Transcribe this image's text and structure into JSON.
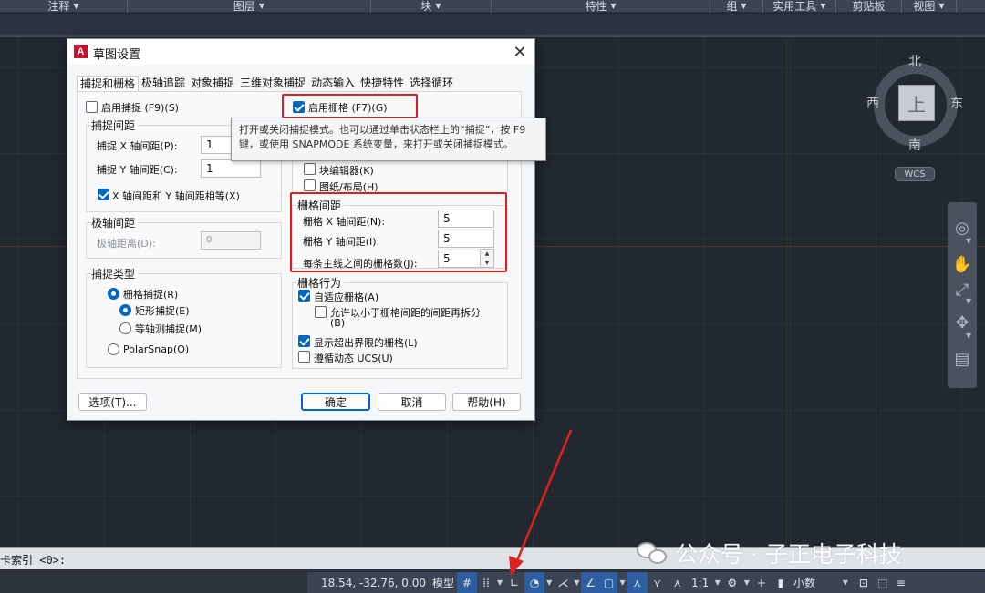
{
  "ribbon": {
    "panels": [
      {
        "label": "注释"
      },
      {
        "label": "图层"
      },
      {
        "label": "块"
      },
      {
        "label": "特性"
      },
      {
        "label": "组"
      },
      {
        "label": "实用工具"
      },
      {
        "label": "剪贴板"
      },
      {
        "label": "视图"
      }
    ]
  },
  "viewcube": {
    "north": "北",
    "south": "南",
    "west": "西",
    "east": "东",
    "face": "上",
    "wcs": "WCS"
  },
  "command": {
    "text": "卡索引 <0>:"
  },
  "watermark": {
    "text": "公众号 · 子正电子科技"
  },
  "statusbar": {
    "coords": "18.54, -32.76, 0.00",
    "model": "模型",
    "scale": "1:1",
    "units": "小数"
  },
  "dialog": {
    "title": "草图设置",
    "tabs": [
      "捕捉和栅格",
      "极轴追踪",
      "对象捕捉",
      "三维对象捕捉",
      "动态输入",
      "快捷特性",
      "选择循环"
    ],
    "snap_on_label": "启用捕捉 (F9)(S)",
    "grid_on_label": "启用栅格 (F7)(G)",
    "snap_spacing_title": "捕捉间距",
    "snap_x_label": "捕捉 X 轴间距(P):",
    "snap_x_value": "1",
    "snap_y_label": "捕捉 Y 轴间距(C):",
    "snap_y_value": "1",
    "equal_xy_label": "X 轴间距和 Y 轴间距相等(X)",
    "polar_title": "极轴间距",
    "polar_label": "极轴距离(D):",
    "polar_value": "0",
    "snap_type_title": "捕捉类型",
    "grid_snap_label": "栅格捕捉(R)",
    "rect_snap_label": "矩形捕捉(E)",
    "iso_snap_label": "等轴测捕捉(M)",
    "polar_snap_label": "PolarSnap(O)",
    "block_editor_label": "块编辑器(K)",
    "paper_layout_label": "图纸/布局(H)",
    "grid_spacing_title": "栅格间距",
    "grid_x_label": "栅格 X 轴间距(N):",
    "grid_x_value": "5",
    "grid_y_label": "栅格 Y 轴间距(I):",
    "grid_y_value": "5",
    "major_label": "每条主线之间的栅格数(J):",
    "major_value": "5",
    "grid_behavior_title": "栅格行为",
    "adaptive_label": "自适应栅格(A)",
    "subdivide_label_1": "允许以小于栅格间距的间距再拆分",
    "subdivide_label_2": "(B)",
    "beyond_limits_label": "显示超出界限的栅格(L)",
    "follow_ucs_label": "遵循动态 UCS(U)",
    "tooltip_line1": "打开或关闭捕捉模式。也可以通过单击状态栏上的“捕捉”，按 F9",
    "tooltip_line2": "键，或使用 SNAPMODE 系统变量，来打开或关闭捕捉模式。",
    "options_btn": "选项(T)...",
    "ok_btn": "确定",
    "cancel_btn": "取消",
    "help_btn": "帮助(H)"
  },
  "colors": {
    "accent": "#0067c0",
    "highlight": "#e0201e",
    "background": "#212830"
  }
}
